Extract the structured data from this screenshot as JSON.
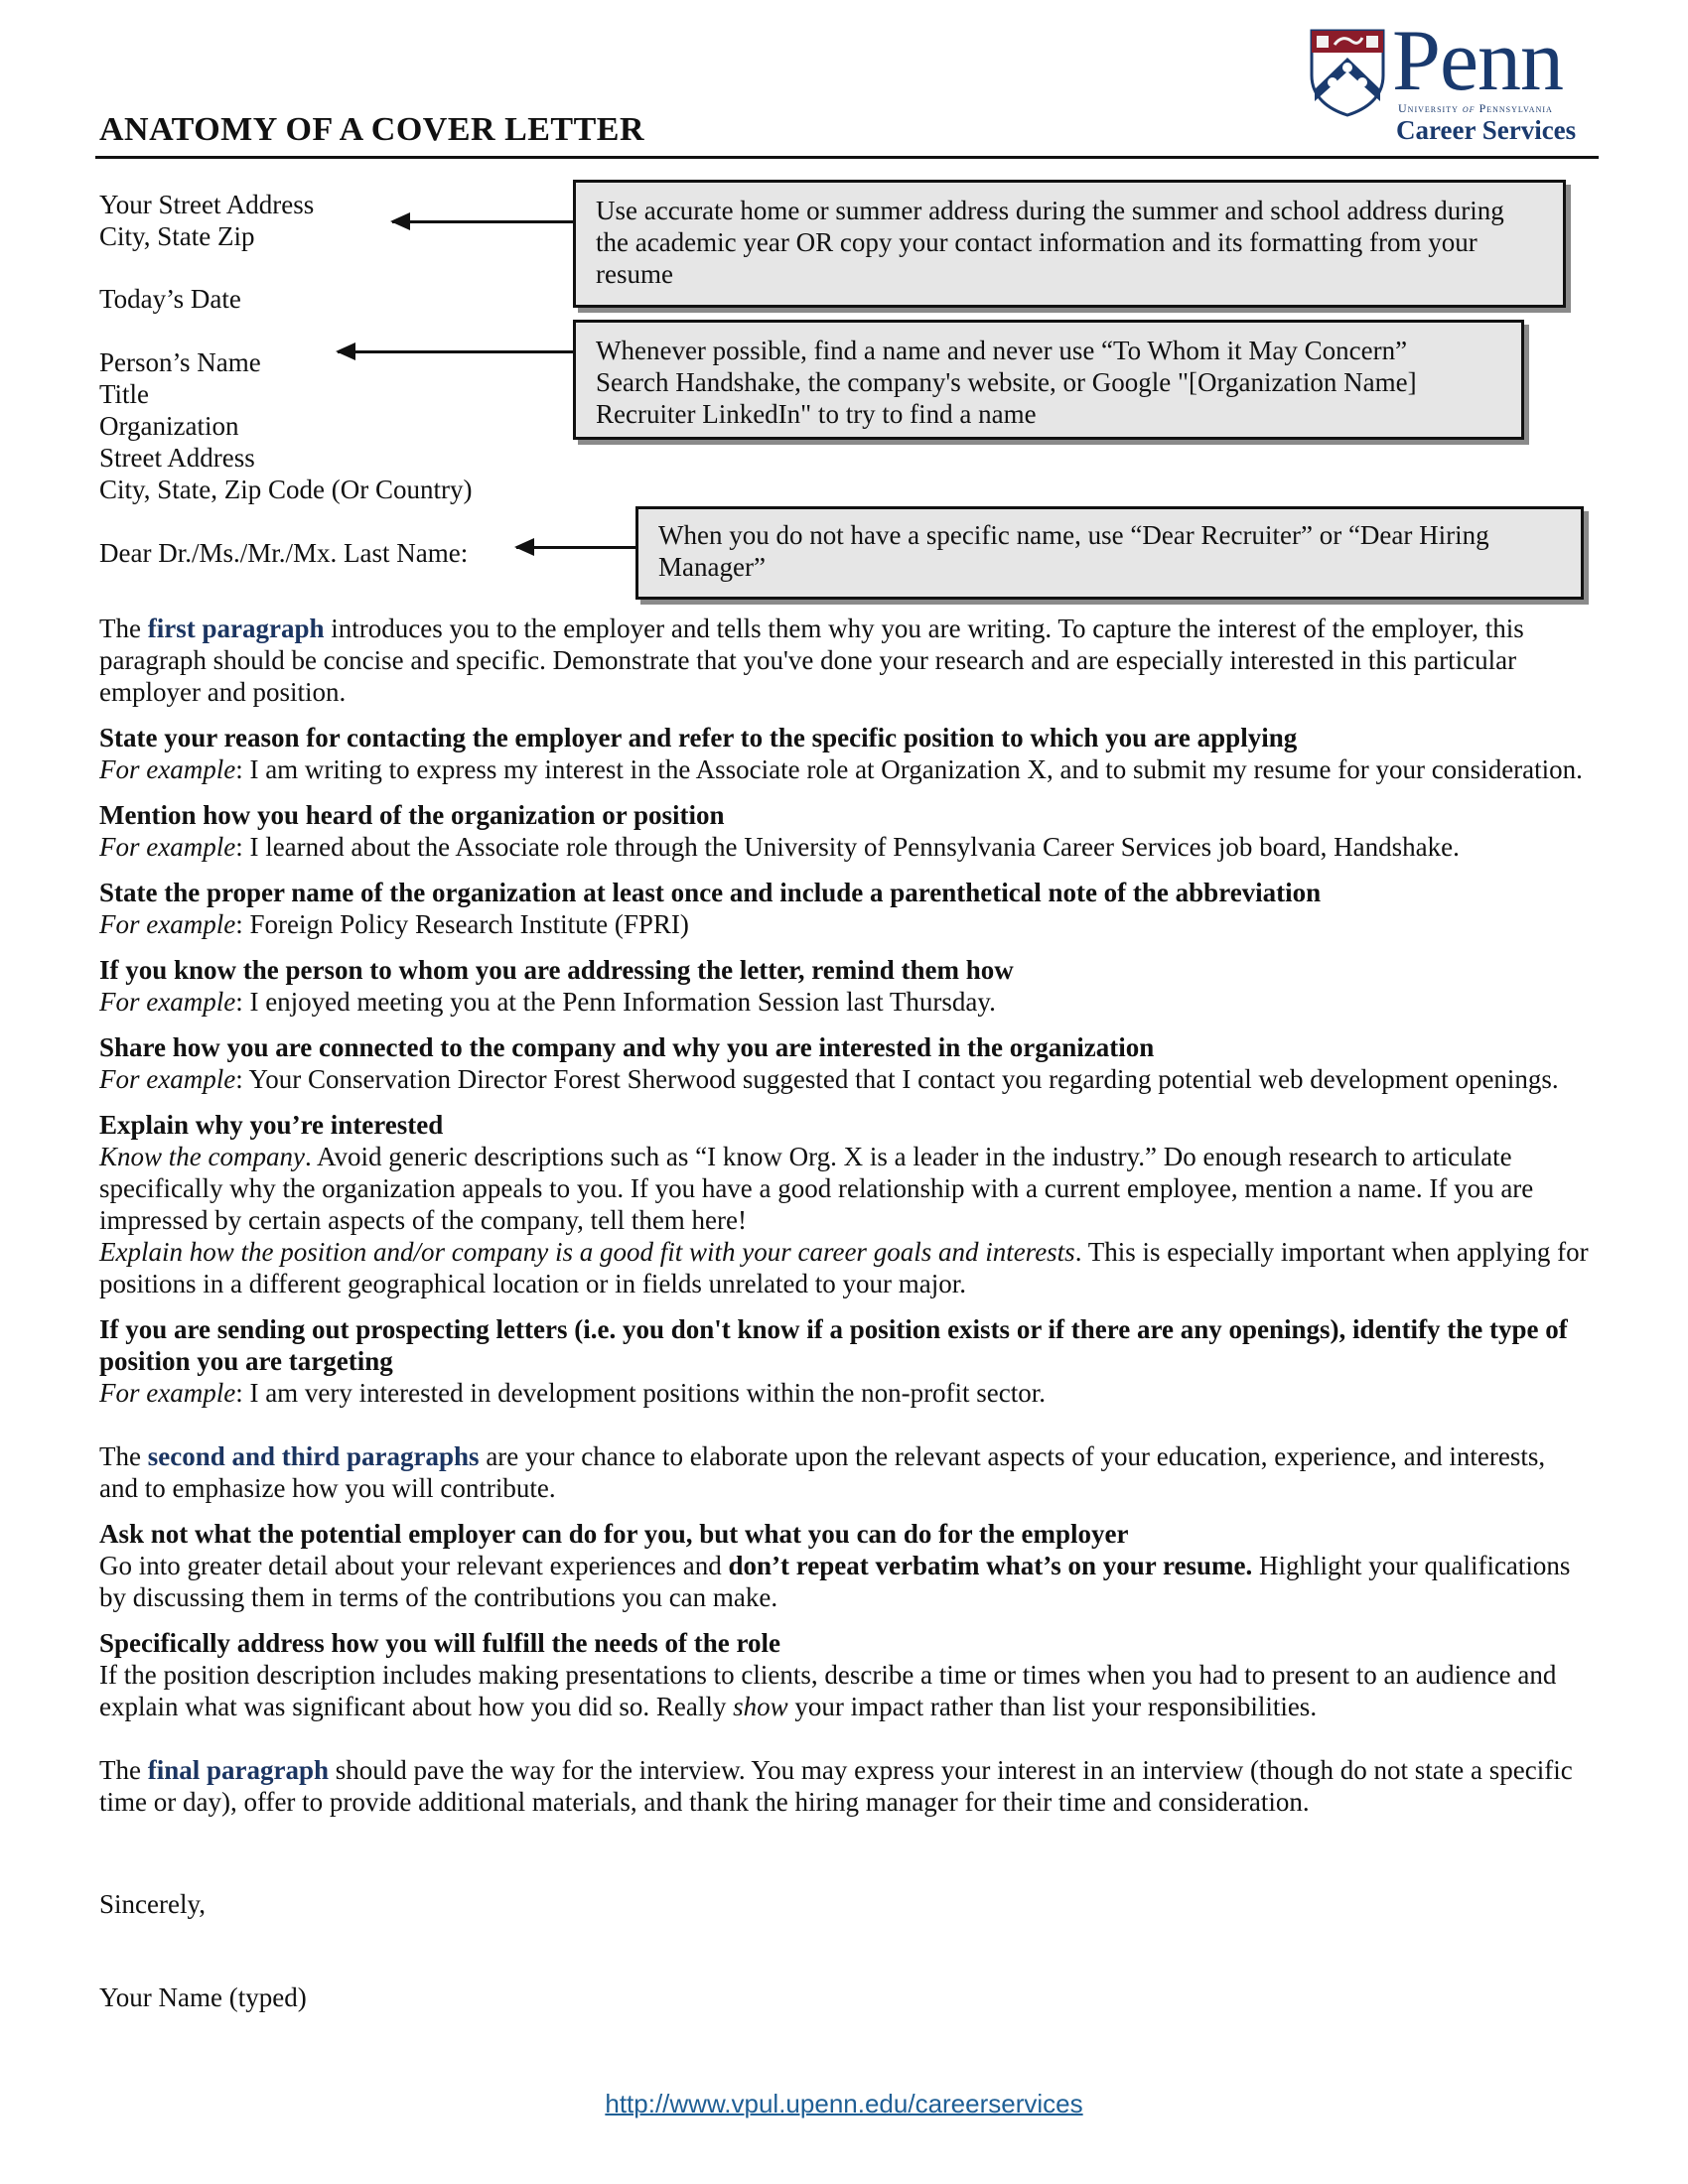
{
  "header": {
    "title": "ANATOMY OF A COVER LETTER",
    "logo": {
      "wordmark": "Penn",
      "university": "University of Pennsylvania",
      "university_pre": "University ",
      "university_of": "of",
      "university_post": " Pennsylvania",
      "department": "Career Services",
      "icon": "penn-shield-icon",
      "colors": {
        "navy": "#1a3a6e",
        "red": "#8b1c2a"
      }
    }
  },
  "sender": {
    "street": "Your Street Address",
    "city_state_zip": "City, State Zip",
    "date": "Today’s Date"
  },
  "recipient": {
    "name": "Person’s Name",
    "title": "Title",
    "organization": "Organization",
    "street": "Street Address",
    "city_line": "City, State, Zip Code (Or Country)"
  },
  "salutation": "Dear Dr./Ms./Mr./Mx. Last Name:",
  "callouts": [
    {
      "text": "Use accurate home or summer address during the summer and school address during the academic year OR copy your contact information and its formatting from your resume"
    },
    {
      "line1": "Whenever possible, find a name and never use “To Whom it May Concern”",
      "line2": "Search Handshake, the company's website, or Google \"[Organization Name] Recruiter LinkedIn\" to try to find a name"
    },
    {
      "text": "When you do not have a specific name, use “Dear Recruiter” or “Dear Hiring Manager”"
    }
  ],
  "first_paragraph": {
    "pre": "The ",
    "highlight": "first paragraph",
    "post": " introduces you to the employer and tells them why you are writing. To capture the interest of the employer, this paragraph should be concise and specific. Demonstrate that you've done your research and are especially interested in this particular employer and position."
  },
  "example_label": "For example",
  "tips_first": [
    {
      "heading": "State your reason for contacting the employer and refer to the specific position to which you are applying",
      "example": ": I am writing to express my interest in the Associate role at Organization X, and to submit my resume for your consideration."
    },
    {
      "heading": "Mention how you heard of the organization or position",
      "example": ": I learned about the Associate role through the University of Pennsylvania Career Services job board, Handshake."
    },
    {
      "heading": "State the proper name of the organization at least once and include a parenthetical note of the abbreviation",
      "example": ": Foreign Policy Research Institute (FPRI)"
    },
    {
      "heading": "If you know the person to whom you are addressing the letter, remind them how",
      "example": ": I enjoyed meeting you at the Penn Information Session last Thursday."
    },
    {
      "heading": "Share how you are connected to the company and why you are interested in the organization",
      "example": ": Your Conservation Director Forest Sherwood suggested that I contact you regarding potential web development openings."
    }
  ],
  "explain_interest": {
    "heading": "Explain why you’re interested",
    "know_label": "Know the company",
    "know_text": ". Avoid generic descriptions such as “I know Org. X is a leader in the industry.” Do enough research to articulate specifically why the organization appeals to you. If you have a good relationship with a current employee, mention a name. If you are impressed by certain aspects of the company, tell them here!",
    "fit_label": "Explain how the position and/or company is a good fit with your career goals and interests",
    "fit_text": ". This is especially important when applying for positions in a different geographical location or in fields unrelated to your major."
  },
  "prospecting": {
    "heading": "If you are sending out prospecting letters (i.e. you don't know if a position exists or if there are any openings), identify the type of position you are targeting",
    "example": ": I am very interested in development positions within the non-profit sector."
  },
  "middle_paragraphs": {
    "pre": "The ",
    "highlight": "second and third paragraphs",
    "post": " are your chance to elaborate upon the relevant aspects of your education, experience, and interests, and to emphasize how you will contribute."
  },
  "ask_not": {
    "heading": "Ask not what the potential employer can do for you, but what you can do for the employer",
    "pre": "Go into greater detail about your relevant experiences and ",
    "bold": "don’t repeat verbatim what’s on your resume.",
    "post": " Highlight your qualifications by discussing them in terms of the contributions you can make."
  },
  "fulfill": {
    "heading": "Specifically address how you will fulfill the needs of the role",
    "pre": "If the position description includes making presentations to clients, describe a time or times when you had to present to an audience and explain what was significant about how you did so. Really ",
    "italic": "show",
    "post": " your impact rather than list your responsibilities."
  },
  "final_paragraph": {
    "pre": "The ",
    "highlight": "final paragraph",
    "post": " should pave the way for the interview. You may express your interest in an interview (though do not state a specific time or day), offer to provide additional materials, and thank the hiring manager for their time and consideration."
  },
  "closing": "Sincerely,",
  "signature": "Your Name (typed)",
  "footer": {
    "link_text": "http://www.vpul.upenn.edu/careerservices"
  }
}
